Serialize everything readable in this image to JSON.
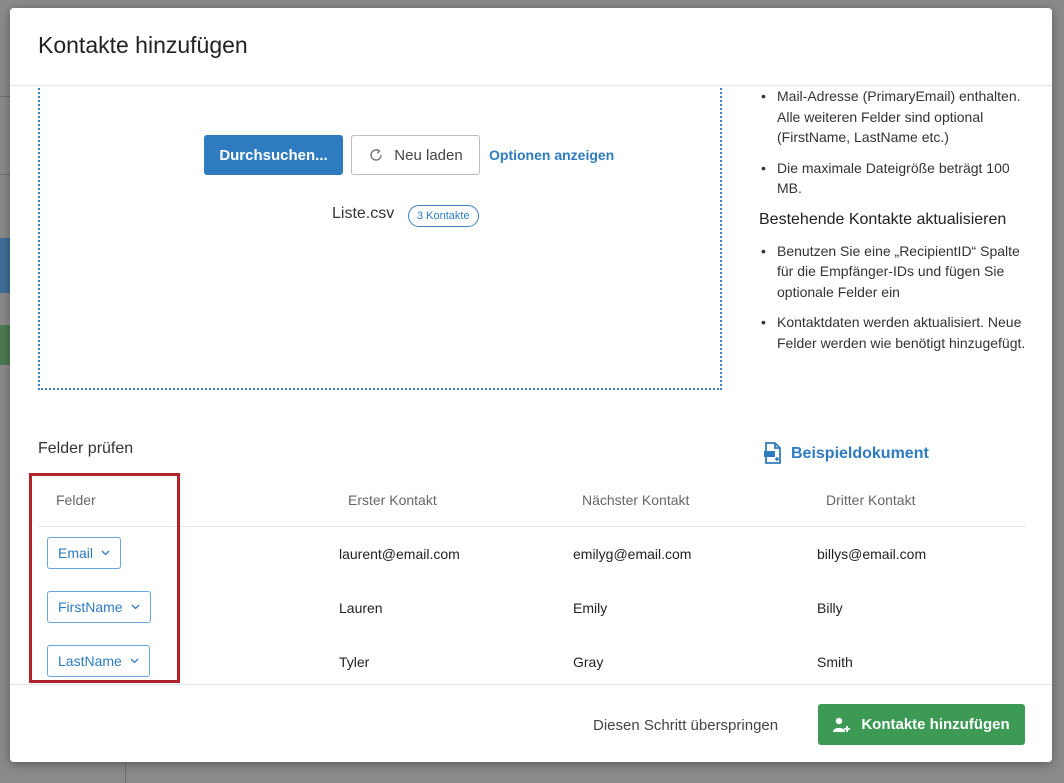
{
  "modal": {
    "title": "Kontakte hinzufügen"
  },
  "upload": {
    "browse_label": "Durchsuchen...",
    "reload_label": "Neu laden",
    "options_link": "Optionen anzeigen",
    "file_name": "Liste.csv",
    "file_badge": "3 Kontakte"
  },
  "info": {
    "bullet1": "Mail-Adresse (PrimaryEmail) enthalten. Alle weiteren Felder sind optional (FirstName, LastName etc.)",
    "bullet2": "Die maximale Dateigröße beträgt 100 MB.",
    "update_heading": "Bestehende Kontakte aktualisieren",
    "bullet3": "Benutzen Sie eine „RecipientID“ Spalte für die Empfänger-IDs und fügen Sie optionale Felder ein",
    "bullet4": "Kontaktdaten werden aktualisiert. Neue Felder werden wie benötigt hinzugefügt."
  },
  "review": {
    "title": "Felder prüfen",
    "sample_doc": "Beispieldokument",
    "columns": [
      "Felder",
      "Erster Kontakt",
      "Nächster Kontakt",
      "Dritter Kontakt"
    ],
    "rows": [
      {
        "field": "Email",
        "values": [
          "laurent@email.com",
          "emilyg@email.com",
          "billys@email.com"
        ]
      },
      {
        "field": "FirstName",
        "values": [
          "Lauren",
          "Emily",
          "Billy"
        ]
      },
      {
        "field": "LastName",
        "values": [
          "Tyler",
          "Gray",
          "Smith"
        ]
      }
    ]
  },
  "footer": {
    "skip_label": "Diesen Schritt überspringen",
    "add_label": "Kontakte hinzufügen"
  },
  "colors": {
    "primary": "#2f7bbf",
    "success": "#3c9a55",
    "highlight": "#b0232a"
  },
  "icons": [
    "reload-icon",
    "document-icon",
    "chevron-down-icon",
    "add-user-icon"
  ]
}
